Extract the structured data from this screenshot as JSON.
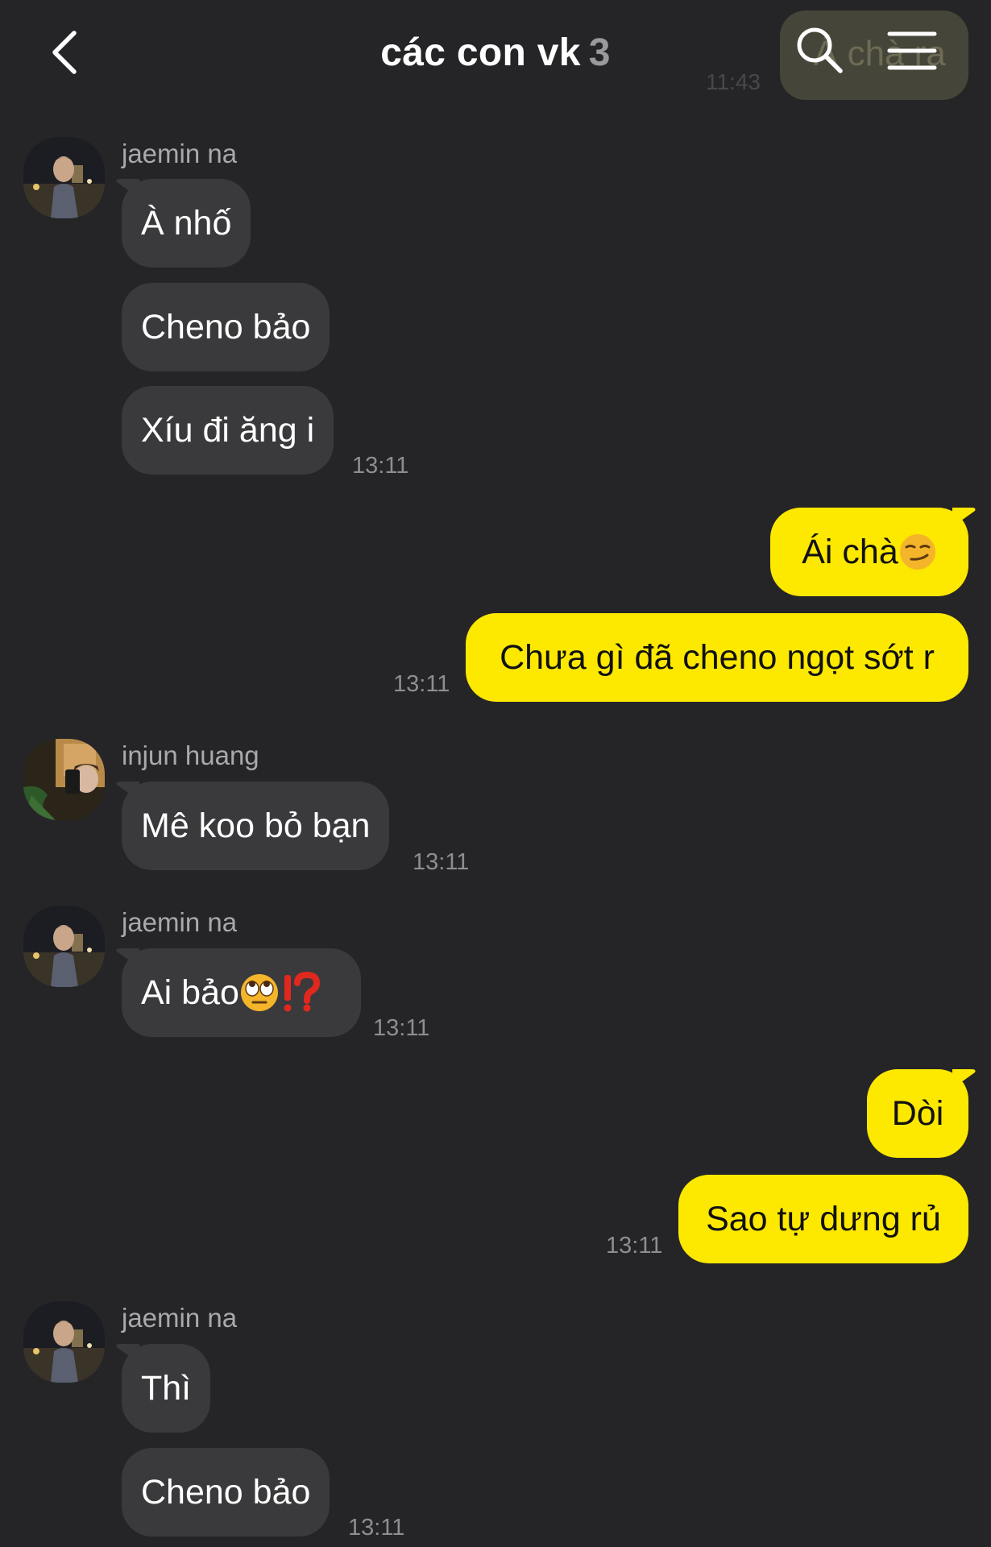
{
  "header": {
    "title": "các con vk",
    "member_count": "3",
    "ghost_bubble_text": "Á chà ra",
    "ghost_time": "11:43"
  },
  "colors": {
    "background": "#252527",
    "incoming_bubble": "#3a3a3c",
    "outgoing_bubble": "#fde800",
    "timestamp": "#8e8e90"
  },
  "messages": [
    {
      "sender": "jaemin na",
      "texts": [
        "À nhố",
        "Cheno bảo",
        "Xíu đi ăng i"
      ],
      "time": "13:11"
    },
    {
      "sender": "me",
      "texts": [
        "Ái chà",
        "Chưa gì đã cheno ngọt sớt r"
      ],
      "time": "13:11"
    },
    {
      "sender": "injun huang",
      "texts": [
        "Mê koo bỏ bạn"
      ],
      "time": "13:11"
    },
    {
      "sender": "jaemin na",
      "texts": [
        "Ai bảo"
      ],
      "time": "13:11"
    },
    {
      "sender": "me",
      "texts": [
        "Dòi",
        "Sao tự dưng rủ"
      ],
      "time": "13:11"
    },
    {
      "sender": "jaemin na",
      "texts": [
        "Thì",
        "Cheno bảo"
      ],
      "time": "13:11"
    }
  ]
}
